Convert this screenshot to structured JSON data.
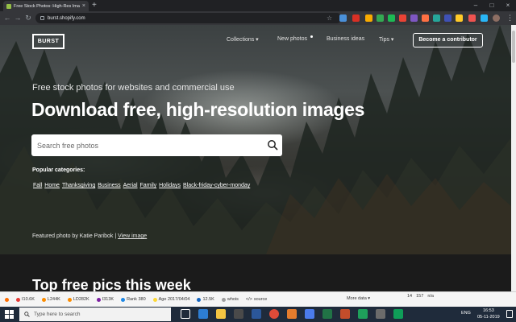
{
  "browser": {
    "tab_title": "Free Stock Photos: High-Res Ima",
    "tab_close": "×",
    "new_tab": "+",
    "url": "burst.shopify.com",
    "minimize": "–",
    "maximize": "□",
    "close": "×",
    "menu": "⋮"
  },
  "site": {
    "logo": "BURST",
    "nav": {
      "collections": "Collections ▾",
      "new_photos": "New photos",
      "business_ideas": "Business ideas",
      "tips": "Tips ▾",
      "contributor": "Become a contributor"
    },
    "tagline": "Free stock photos for websites and commercial use",
    "headline": "Download free, high-resolution images",
    "search_placeholder": "Search free photos",
    "popular_label": "Popular categories:",
    "categories": [
      "Fall",
      "Home",
      "Thanksgiving",
      "Business",
      "Aerial",
      "Family",
      "Holidays",
      "Black-friday-cyber-monday"
    ],
    "credit_prefix": "Featured photo by Katie Paribok |",
    "credit_link": "View image",
    "section_title": "Top free pics this week"
  },
  "seo_bar": {
    "items": [
      "I10.6K",
      "L244K",
      "LD282K",
      "I313K",
      "Rank 380",
      "Age 2017/04/04",
      "12.5K",
      "whois",
      "source"
    ],
    "more": "More data ▾",
    "r1": "14",
    "r2": "157",
    "r3": "n/a"
  },
  "taskbar": {
    "search_text": "Type here to search",
    "lang": "ENG",
    "time": "16:53",
    "date": "05-11-2019"
  },
  "colors": {
    "accent_green": "#95bf47",
    "taskbar": "#1f2b3b"
  }
}
